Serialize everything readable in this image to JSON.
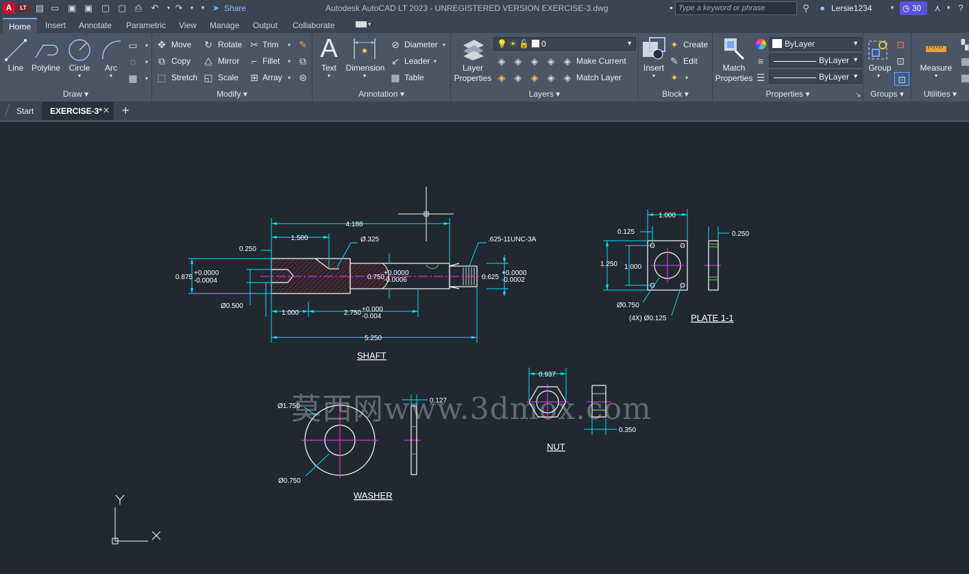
{
  "app": {
    "title": "Autodesk AutoCAD LT 2023 - UNREGISTERED VERSION    EXERCISE-3.dwg",
    "logo_letter": "A",
    "logo_sub": "LT",
    "share": "Share"
  },
  "search": {
    "placeholder": "Type a keyword or phrase"
  },
  "user": {
    "name": "Lersie1234",
    "trial_days": "30"
  },
  "ribbon_tabs": [
    "Home",
    "Insert",
    "Annotate",
    "Parametric",
    "View",
    "Manage",
    "Output",
    "Collaborate"
  ],
  "draw": {
    "line": "Line",
    "polyline": "Polyline",
    "circle": "Circle",
    "arc": "Arc",
    "title": "Draw"
  },
  "modify": {
    "move": "Move",
    "rotate": "Rotate",
    "trim": "Trim",
    "copy": "Copy",
    "mirror": "Mirror",
    "fillet": "Fillet",
    "stretch": "Stretch",
    "scale": "Scale",
    "array": "Array",
    "title": "Modify"
  },
  "annotation": {
    "text": "Text",
    "dimension": "Dimension",
    "diameter": "Diameter",
    "leader": "Leader",
    "table": "Table",
    "title": "Annotation"
  },
  "layers": {
    "properties_line1": "Layer",
    "properties_line2": "Properties",
    "current_layer": "0",
    "make_current": "Make Current",
    "match_layer": "Match Layer",
    "title": "Layers"
  },
  "block": {
    "insert": "Insert",
    "create": "Create",
    "edit": "Edit",
    "title": "Block"
  },
  "properties": {
    "match_line1": "Match",
    "match_line2": "Properties",
    "color": "ByLayer",
    "linetype": "ByLayer",
    "lineweight": "ByLayer",
    "title": "Properties"
  },
  "groups": {
    "group": "Group",
    "title": "Groups"
  },
  "utilities": {
    "measure": "Measure",
    "title": "Utilities"
  },
  "doc_tabs": {
    "start": "Start",
    "active": "EXERCISE-3*",
    "new_tab": "+"
  },
  "drawing": {
    "labels": {
      "shaft": "SHAFT",
      "plate": "PLATE 1-1",
      "washer": "WASHER",
      "nut": "NUT"
    },
    "shaft_dims": {
      "overall_top": "4.188",
      "left_len": "1.500",
      "hole": "Ø.325",
      "thread": ".625-11UNC-3A",
      "d250": "0.250",
      "tol_left_top": "+0.0000",
      "tol_left_bot": "-0.0004",
      "dia875": "0.875",
      "dia500": "Ø0.500",
      "d1000": "1.000",
      "d2750": "2.750",
      "tol_mid_top": "+0.000",
      "tol_mid_bot": "-0.004",
      "overall": "5.250",
      "mid_dia": "0.750",
      "mid_tol_top": "+0.0000",
      "mid_tol_bot": "-0.0006",
      "right_dia": "0.625",
      "right_tol_top": "+0.0000",
      "right_tol_bot": "-0.0002"
    },
    "plate_dims": {
      "top": "1.000",
      "d125": "0.125",
      "d1250": "1.250",
      "d1000": "1.000",
      "bore": "Ø0.750",
      "holes": "(4X) Ø0.125",
      "thick": "0.250"
    },
    "washer_dims": {
      "outer": "Ø1.750",
      "inner": "Ø0.750",
      "thick": "0.127"
    },
    "nut_dims": {
      "flats": "0.937",
      "thick": "0.350"
    },
    "ucs": {
      "x": "X",
      "y": "Y"
    }
  },
  "watermark": "莫西网www.3dmox.com"
}
